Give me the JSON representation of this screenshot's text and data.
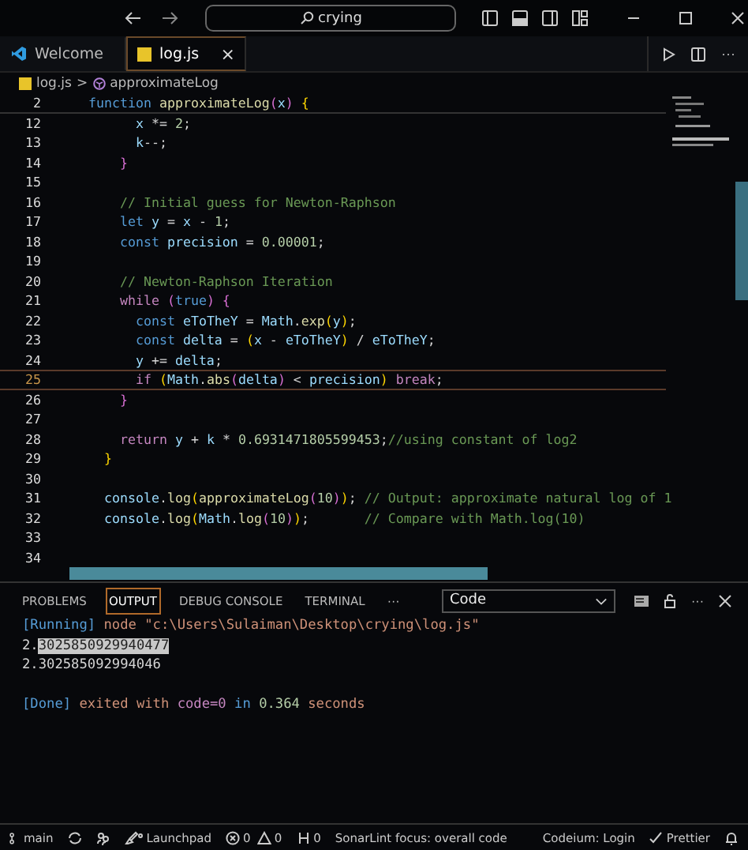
{
  "title_bar": {
    "search": "crying"
  },
  "tabs": [
    {
      "label": "Welcome",
      "selected": false
    },
    {
      "label": "log.js",
      "selected": true
    }
  ],
  "close_glyph": "×",
  "breadcrumb": {
    "file": "log.js",
    "separator": ">",
    "symbol": "approximateLog"
  },
  "sticky_line": {
    "number": "2",
    "tokens": [
      {
        "text": "function ",
        "kind": "kw"
      },
      {
        "text": "approximateLog",
        "kind": "fn"
      },
      {
        "text": "(",
        "kind": "paren"
      },
      {
        "text": "x",
        "kind": "var"
      },
      {
        "text": ")",
        "kind": "paren"
      },
      {
        "text": " {",
        "kind": "brace"
      }
    ]
  },
  "lines": [
    {
      "number": "12",
      "current": false,
      "tokens": [
        {
          "text": "      x",
          "kind": "var"
        },
        {
          "text": " *= ",
          "kind": "plain"
        },
        {
          "text": "2",
          "kind": "num"
        },
        {
          "text": ";",
          "kind": "plain"
        }
      ]
    },
    {
      "number": "13",
      "current": false,
      "tokens": [
        {
          "text": "      k",
          "kind": "var"
        },
        {
          "text": "--;",
          "kind": "plain"
        }
      ]
    },
    {
      "number": "14",
      "current": false,
      "tokens": [
        {
          "text": "    }",
          "kind": "paren"
        }
      ]
    },
    {
      "number": "15",
      "current": false
    },
    {
      "number": "16",
      "current": false,
      "tokens": [
        {
          "text": "    // Initial guess for Newton-Raphson",
          "kind": "cmt"
        }
      ]
    },
    {
      "number": "17",
      "current": false,
      "tokens": [
        {
          "text": "    let ",
          "kind": "kw"
        },
        {
          "text": "y",
          "kind": "var"
        },
        {
          "text": " = ",
          "kind": "plain"
        },
        {
          "text": "x",
          "kind": "var"
        },
        {
          "text": " - ",
          "kind": "plain"
        },
        {
          "text": "1",
          "kind": "num"
        },
        {
          "text": ";",
          "kind": "plain"
        }
      ]
    },
    {
      "number": "18",
      "current": false,
      "tokens": [
        {
          "text": "    const ",
          "kind": "kw"
        },
        {
          "text": "precision",
          "kind": "var"
        },
        {
          "text": " = ",
          "kind": "plain"
        },
        {
          "text": "0.00001",
          "kind": "num"
        },
        {
          "text": ";",
          "kind": "plain"
        }
      ]
    },
    {
      "number": "19",
      "current": false
    },
    {
      "number": "20",
      "current": false,
      "tokens": [
        {
          "text": "    // Newton-Raphson Iteration",
          "kind": "cmt"
        }
      ]
    },
    {
      "number": "21",
      "current": false,
      "tokens": [
        {
          "text": "    while ",
          "kind": "ctrl"
        },
        {
          "text": "(",
          "kind": "paren"
        },
        {
          "text": "true",
          "kind": "kw"
        },
        {
          "text": ") {",
          "kind": "paren"
        }
      ]
    },
    {
      "number": "22",
      "current": false,
      "tokens": [
        {
          "text": "      const ",
          "kind": "kw"
        },
        {
          "text": "eToTheY",
          "kind": "var"
        },
        {
          "text": " = ",
          "kind": "plain"
        },
        {
          "text": "Math",
          "kind": "var"
        },
        {
          "text": ".",
          "kind": "plain"
        },
        {
          "text": "exp",
          "kind": "fn"
        },
        {
          "text": "(",
          "kind": "brace"
        },
        {
          "text": "y",
          "kind": "var"
        },
        {
          "text": ")",
          "kind": "brace"
        },
        {
          "text": ";",
          "kind": "plain"
        }
      ]
    },
    {
      "number": "23",
      "current": false,
      "tokens": [
        {
          "text": "      const ",
          "kind": "kw"
        },
        {
          "text": "delta",
          "kind": "var"
        },
        {
          "text": " = ",
          "kind": "plain"
        },
        {
          "text": "(",
          "kind": "brace"
        },
        {
          "text": "x",
          "kind": "var"
        },
        {
          "text": " - ",
          "kind": "plain"
        },
        {
          "text": "eToTheY",
          "kind": "var"
        },
        {
          "text": ")",
          "kind": "brace"
        },
        {
          "text": " / ",
          "kind": "plain"
        },
        {
          "text": "eToTheY",
          "kind": "var"
        },
        {
          "text": ";",
          "kind": "plain"
        }
      ]
    },
    {
      "number": "24",
      "current": false,
      "tokens": [
        {
          "text": "      y",
          "kind": "var"
        },
        {
          "text": " += ",
          "kind": "plain"
        },
        {
          "text": "delta",
          "kind": "var"
        },
        {
          "text": ";",
          "kind": "plain"
        }
      ]
    },
    {
      "number": "25",
      "current": true,
      "tokens": [
        {
          "text": "      if ",
          "kind": "ctrl"
        },
        {
          "text": "(",
          "kind": "brace"
        },
        {
          "text": "Math",
          "kind": "var"
        },
        {
          "text": ".",
          "kind": "plain"
        },
        {
          "text": "abs",
          "kind": "fn"
        },
        {
          "text": "(",
          "kind": "paren"
        },
        {
          "text": "delta",
          "kind": "var"
        },
        {
          "text": ")",
          "kind": "paren"
        },
        {
          "text": " < ",
          "kind": "plain"
        },
        {
          "text": "precision",
          "kind": "var"
        },
        {
          "text": ")",
          "kind": "brace"
        },
        {
          "text": " break",
          "kind": "ctrl"
        },
        {
          "text": ";",
          "kind": "plain"
        }
      ]
    },
    {
      "number": "26",
      "current": false,
      "tokens": [
        {
          "text": "    }",
          "kind": "paren"
        }
      ]
    },
    {
      "number": "27",
      "current": false
    },
    {
      "number": "28",
      "current": false,
      "tokens": [
        {
          "text": "    return ",
          "kind": "ctrl"
        },
        {
          "text": "y",
          "kind": "var"
        },
        {
          "text": " + ",
          "kind": "plain"
        },
        {
          "text": "k",
          "kind": "var"
        },
        {
          "text": " * ",
          "kind": "plain"
        },
        {
          "text": "0.6931471805599453",
          "kind": "num"
        },
        {
          "text": ";",
          "kind": "plain"
        },
        {
          "text": "//using constant of log2",
          "kind": "cmt"
        }
      ]
    },
    {
      "number": "29",
      "current": false,
      "tokens": [
        {
          "text": "  }",
          "kind": "brace"
        }
      ]
    },
    {
      "number": "30",
      "current": false
    },
    {
      "number": "31",
      "current": false,
      "tokens": [
        {
          "text": "  console",
          "kind": "var"
        },
        {
          "text": ".",
          "kind": "plain"
        },
        {
          "text": "log",
          "kind": "fn"
        },
        {
          "text": "(",
          "kind": "brace"
        },
        {
          "text": "approximateLog",
          "kind": "fn"
        },
        {
          "text": "(",
          "kind": "paren"
        },
        {
          "text": "10",
          "kind": "num"
        },
        {
          "text": ")",
          "kind": "paren"
        },
        {
          "text": ")",
          "kind": "brace"
        },
        {
          "text": ";",
          "kind": "plain"
        },
        {
          "text": " // Output: approximate natural log of 1",
          "kind": "cmt"
        }
      ]
    },
    {
      "number": "32",
      "current": false,
      "tokens": [
        {
          "text": "  console",
          "kind": "var"
        },
        {
          "text": ".",
          "kind": "plain"
        },
        {
          "text": "log",
          "kind": "fn"
        },
        {
          "text": "(",
          "kind": "brace"
        },
        {
          "text": "Math",
          "kind": "var"
        },
        {
          "text": ".",
          "kind": "plain"
        },
        {
          "text": "log",
          "kind": "fn"
        },
        {
          "text": "(",
          "kind": "paren"
        },
        {
          "text": "10",
          "kind": "num"
        },
        {
          "text": ")",
          "kind": "paren"
        },
        {
          "text": ")",
          "kind": "brace"
        },
        {
          "text": ";",
          "kind": "plain"
        },
        {
          "text": "       // Compare with Math.log(10)",
          "kind": "cmt"
        }
      ]
    },
    {
      "number": "33",
      "current": false
    },
    {
      "number": "34",
      "current": false
    }
  ],
  "panel": {
    "tabs": [
      {
        "label": "PROBLEMS",
        "selected": false
      },
      {
        "label": "OUTPUT",
        "selected": true
      },
      {
        "label": "DEBUG CONSOLE",
        "selected": false
      },
      {
        "label": "TERMINAL",
        "selected": false
      }
    ],
    "more": "···",
    "dropdown": "Code",
    "run_lines": [
      [
        {
          "text": "[Running]",
          "kind": "tag",
          "selected": false
        },
        {
          "text": " node \"c:\\Users\\Sulaiman\\Desktop\\crying\\log.js\"",
          "kind": "str",
          "selected": false
        }
      ],
      [
        {
          "text": "2.",
          "kind": "plain",
          "selected": false
        },
        {
          "text": "3025850929940477",
          "kind": "plain",
          "selected": true
        }
      ],
      [
        {
          "text": "2.302585092994046",
          "kind": "plain",
          "selected": false
        }
      ]
    ],
    "done_line": [
      {
        "text": "[Done]",
        "kind": "tag",
        "selected": false
      },
      {
        "text": " exited with ",
        "kind": "str",
        "selected": false
      },
      {
        "text": "code=0",
        "kind": "code",
        "selected": false
      },
      {
        "text": " in ",
        "kind": "tag",
        "selected": false
      },
      {
        "text": "0.364",
        "kind": "num",
        "selected": false
      },
      {
        "text": " seconds",
        "kind": "str",
        "selected": false
      }
    ]
  },
  "tab_actions_more": "···",
  "status_bar": {
    "branch": "main",
    "launchpad": "Launchpad",
    "errors": "0",
    "warnings": "0",
    "ports": "0",
    "sonarlint": "SonarLint focus: overall code",
    "codeium": "Codeium: Login",
    "prettier": "Prettier"
  }
}
